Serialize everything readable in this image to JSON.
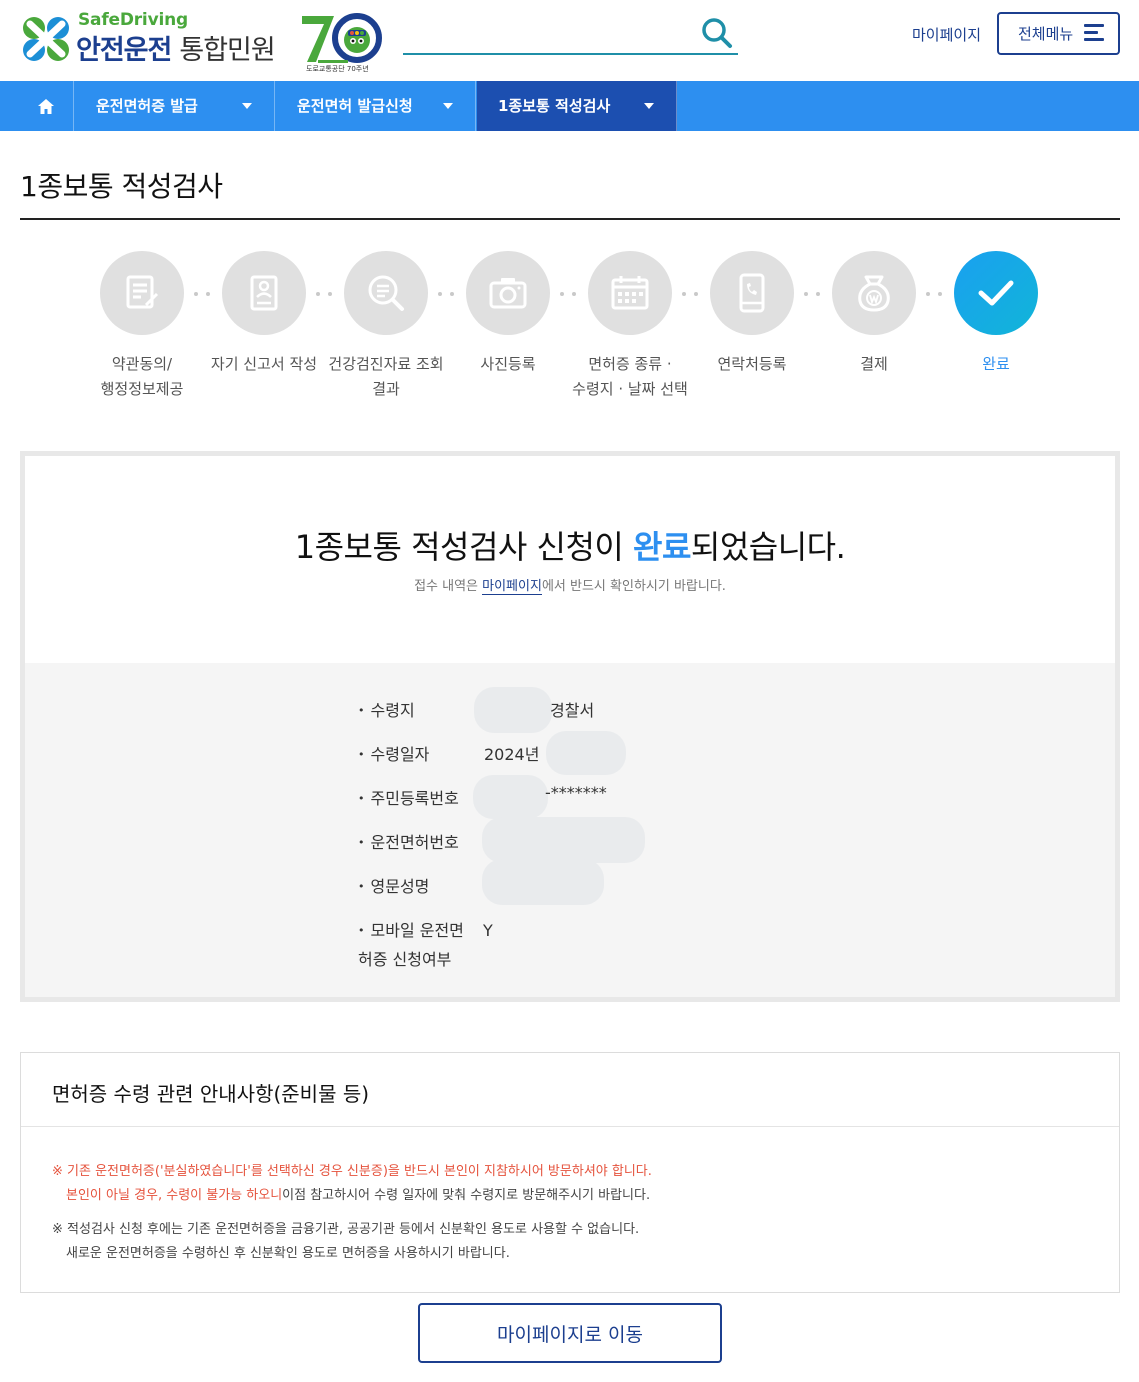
{
  "header": {
    "logo_en": "SafeDriving",
    "logo_ko_a": "안전운전",
    "logo_ko_b": "통합민원",
    "logo_70_caption": "도로교통공단 70주년",
    "search_value": "",
    "mypage_label": "마이페이지",
    "allmenu_label": "전체메뉴",
    "brand_color": "#1c3f8f",
    "accent_color": "#2d8ff0"
  },
  "breadcrumb": {
    "home_icon": "home-icon",
    "items": [
      {
        "label": "운전면허증 발급"
      },
      {
        "label": "운전면허 발급신청"
      },
      {
        "label": "1종보통 적성검사"
      }
    ]
  },
  "page": {
    "title": "1종보통 적성검사"
  },
  "steps": [
    {
      "label": "약관동의/\n행정정보제공",
      "icon": "document-icon",
      "done": false
    },
    {
      "label": "자기 신고서 작성",
      "icon": "form-icon",
      "done": false
    },
    {
      "label": "건강검진자료 조회\n결과",
      "icon": "search-document-icon",
      "done": false
    },
    {
      "label": "사진등록",
      "icon": "camera-icon",
      "done": false
    },
    {
      "label": "면허증 종류 ·\n수령지 · 날짜 선택",
      "icon": "calendar-icon",
      "done": false
    },
    {
      "label": "연락처등록",
      "icon": "phone-icon",
      "done": false
    },
    {
      "label": "결제",
      "icon": "money-bag-icon",
      "done": false
    },
    {
      "label": "완료",
      "icon": "check-icon",
      "done": true
    }
  ],
  "result": {
    "title_pre": "1종보통 적성검사 신청이 ",
    "title_hl": "완료",
    "title_post": "되었습니다.",
    "sub_pre": "접수 내역은 ",
    "sub_link": "마이페이지",
    "sub_post": "에서 반드시 확인하시기 바랍니다.",
    "details": [
      {
        "label": "수령지",
        "value": "경찰서"
      },
      {
        "label": "수령일자",
        "value": "2024년"
      },
      {
        "label": "주민등록번호",
        "value": "-*******"
      },
      {
        "label": "운전면허번호",
        "value": ""
      },
      {
        "label": "영문성명",
        "value": ""
      },
      {
        "label": "모바일 운전면\n허증 신청여부",
        "value": "Y"
      }
    ]
  },
  "notice": {
    "title": "면허증 수령 관련 안내사항(준비물 등)",
    "line1_red": "※ 기존 운전면허증('분실하였습니다'를 선택하신 경우 신분증)을 반드시 본인이 지참하시어 방문하셔야 합니다.",
    "line2_red": "본인이 아닐 경우, 수령이 불가능 하오니",
    "line2_rest": "이점 참고하시어 수령 일자에 맞춰 수령지로 방문해주시기 바랍니다.",
    "line3": "※ 적성검사 신청 후에는 기존 운전면허증을 금융기관, 공공기관 등에서 신분확인 용도로 사용할 수 없습니다.",
    "line4": "새로운 운전면허증을 수령하신 후 신분확인 용도로 면허증을 사용하시기 바랍니다.",
    "warning_color": "#e5533d"
  },
  "footer": {
    "button_label": "마이페이지로 이동"
  }
}
